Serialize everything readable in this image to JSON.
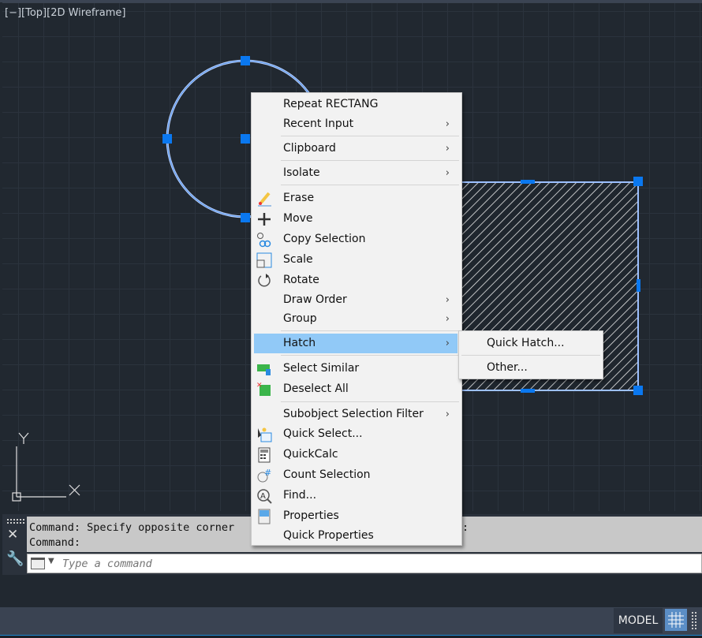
{
  "viewport": {
    "label": "[−][Top][2D Wireframe]",
    "axis_x": "X",
    "axis_y": "Y"
  },
  "colors": {
    "selection": "#4f8fe8",
    "grip": "#0a78f0",
    "menu_highlight": "#91c9f7",
    "background": "#212830"
  },
  "context_menu": {
    "items": [
      {
        "label": "Repeat RECTANG",
        "submenu": false
      },
      {
        "label": "Recent Input",
        "submenu": true
      },
      {
        "label": "Clipboard",
        "submenu": true
      },
      {
        "label": "Isolate",
        "submenu": true
      },
      {
        "label": "Erase",
        "icon": "erase-icon"
      },
      {
        "label": "Move",
        "icon": "move-icon"
      },
      {
        "label": "Copy Selection",
        "icon": "copy-icon"
      },
      {
        "label": "Scale",
        "icon": "scale-icon"
      },
      {
        "label": "Rotate",
        "icon": "rotate-icon"
      },
      {
        "label": "Draw Order",
        "submenu": true
      },
      {
        "label": "Group",
        "submenu": true
      },
      {
        "label": "Hatch",
        "submenu": true,
        "highlighted": true
      },
      {
        "label": "Select Similar",
        "icon": "select-similar-icon"
      },
      {
        "label": "Deselect All",
        "icon": "deselect-all-icon"
      },
      {
        "label": "Subobject Selection Filter",
        "submenu": true
      },
      {
        "label": "Quick Select...",
        "icon": "quick-select-icon"
      },
      {
        "label": "QuickCalc",
        "icon": "calculator-icon"
      },
      {
        "label": "Count Selection",
        "icon": "count-icon"
      },
      {
        "label": "Find...",
        "icon": "find-icon"
      },
      {
        "label": "Properties",
        "icon": "properties-icon"
      },
      {
        "label": "Quick Properties"
      }
    ]
  },
  "hatch_submenu": {
    "items": [
      "Quick Hatch...",
      "Other..."
    ]
  },
  "command_line": {
    "history": [
      "Command: Specify opposite corner",
      ":",
      "Command:"
    ],
    "placeholder": "Type a command"
  },
  "status_bar": {
    "model": "MODEL"
  }
}
